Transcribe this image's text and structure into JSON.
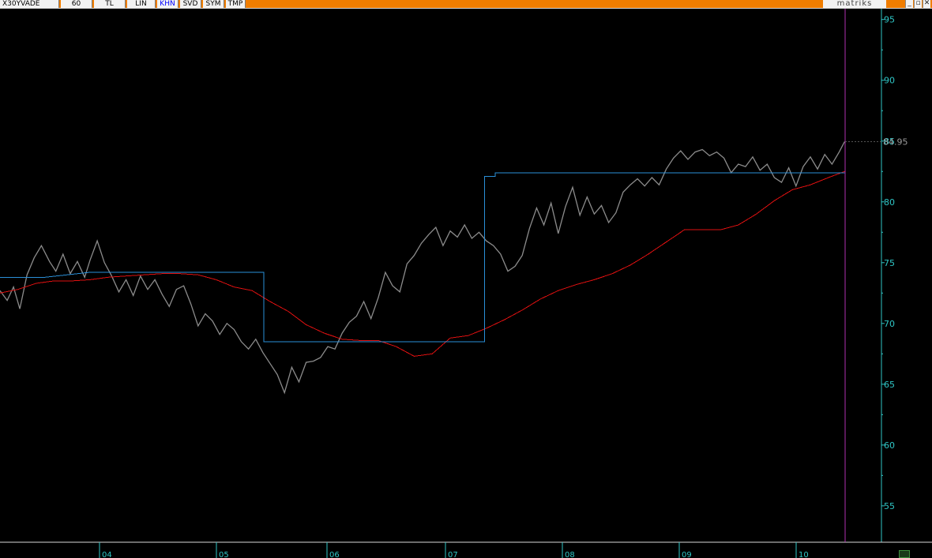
{
  "toolbar": {
    "symbol": "X30YVADE",
    "period": "60",
    "currency": "TL",
    "scale": "LIN",
    "mode": "KHN",
    "svd": "SVD",
    "sym": "SYM",
    "tmp": "TMP",
    "brand": "matriks",
    "minimize": "_",
    "restore": "▫",
    "close": "✕"
  },
  "colors": {
    "background": "#000000",
    "toolbar": "#f07d00",
    "axis": "#2fc6c6",
    "price": "#8c8c8c",
    "red_line": "#e01010",
    "blue_line": "#2a8fd8",
    "cursor": "#b02fb0"
  },
  "chart_data": {
    "type": "line",
    "title": "",
    "ylim": [
      53.5,
      95.5
    ],
    "yticks": [
      55,
      60,
      65,
      70,
      75,
      80,
      85,
      90,
      95
    ],
    "xticks": [
      "04",
      "05",
      "06",
      "07",
      "08",
      "09",
      "10"
    ],
    "last_value": "84.95",
    "series": [
      {
        "color": "#8c8c8c",
        "x": [
          0,
          0.08,
          0.15,
          0.22,
          0.3,
          0.38,
          0.46,
          0.55,
          0.62,
          0.7,
          0.78,
          0.86,
          0.94,
          1.0,
          1.08,
          1.16,
          1.24,
          1.32,
          1.4,
          1.48,
          1.56,
          1.64,
          1.72,
          1.8,
          1.88,
          1.96,
          2.04,
          2.12,
          2.2,
          2.28,
          2.36,
          2.44,
          2.52,
          2.6,
          2.68,
          2.76,
          2.84,
          2.92,
          3.0,
          3.08,
          3.16,
          3.24,
          3.32,
          3.4,
          3.48,
          3.56,
          3.64,
          3.72,
          3.8,
          3.88,
          3.96,
          4.04,
          4.12,
          4.2,
          4.28,
          4.36,
          4.44,
          4.52,
          4.6,
          4.68,
          4.76,
          4.84,
          4.92,
          5.0,
          5.08,
          5.16,
          5.24,
          5.32,
          5.4,
          5.48,
          5.56,
          5.64,
          5.72,
          5.8,
          5.88,
          5.96,
          6.04,
          6.12,
          6.2,
          6.28,
          6.36,
          6.44,
          6.52,
          6.6,
          6.68,
          6.76,
          6.84,
          6.92,
          7.0,
          7.08,
          7.16,
          7.24,
          7.32,
          7.4,
          7.48,
          7.56,
          7.64,
          7.72,
          7.8,
          7.88,
          7.96,
          8.04,
          8.12,
          8.2,
          8.28,
          8.36,
          8.44,
          8.52,
          8.6,
          8.68,
          8.76,
          8.84,
          8.92,
          9.0,
          9.08,
          9.16,
          9.24,
          9.32,
          9.38
        ],
        "values": [
          72.7,
          71.9,
          73.0,
          71.2,
          74.0,
          75.4,
          76.4,
          75.1,
          74.3,
          75.7,
          74.1,
          75.1,
          73.8,
          75.2,
          76.8,
          75.0,
          73.9,
          72.6,
          73.6,
          72.3,
          73.9,
          72.8,
          73.6,
          72.4,
          71.4,
          72.8,
          73.1,
          71.6,
          69.8,
          70.8,
          70.2,
          69.1,
          70.0,
          69.5,
          68.5,
          67.9,
          68.7,
          67.6,
          66.7,
          65.8,
          64.3,
          66.4,
          65.2,
          66.8,
          66.9,
          67.2,
          68.1,
          67.9,
          69.2,
          70.1,
          70.6,
          71.8,
          70.4,
          72.1,
          74.2,
          73.1,
          72.6,
          74.9,
          75.6,
          76.6,
          77.3,
          77.9,
          76.4,
          77.6,
          77.1,
          78.1,
          77.0,
          77.5,
          76.8,
          76.4,
          75.7,
          74.3,
          74.7,
          75.6,
          77.8,
          79.5,
          78.1,
          79.9,
          77.4,
          79.6,
          81.2,
          78.9,
          80.4,
          79.0,
          79.7,
          78.3,
          79.1,
          80.8,
          81.4,
          81.9,
          81.3,
          82.0,
          81.4,
          82.7,
          83.6,
          84.2,
          83.5,
          84.1,
          84.3,
          83.8,
          84.1,
          83.6,
          82.4,
          83.1,
          82.9,
          83.7,
          82.6,
          83.1,
          82.0,
          81.6,
          82.8,
          81.3,
          82.9,
          83.7,
          82.7,
          83.9,
          83.1,
          84.1,
          84.95
        ]
      },
      {
        "color": "#e01010",
        "x": [
          0,
          0.2,
          0.4,
          0.6,
          0.8,
          1.0,
          1.2,
          1.4,
          1.6,
          1.8,
          2.0,
          2.2,
          2.4,
          2.6,
          2.8,
          3.0,
          3.2,
          3.4,
          3.6,
          3.8,
          4.0,
          4.2,
          4.4,
          4.6,
          4.8,
          5.0,
          5.2,
          5.4,
          5.6,
          5.8,
          6.0,
          6.2,
          6.4,
          6.6,
          6.8,
          7.0,
          7.2,
          7.4,
          7.6,
          7.8,
          8.0,
          8.2,
          8.4,
          8.6,
          8.8,
          9.0,
          9.2,
          9.38
        ],
        "values": [
          72.5,
          72.8,
          73.3,
          73.5,
          73.5,
          73.6,
          73.8,
          73.9,
          74.0,
          74.1,
          74.1,
          74.0,
          73.6,
          73.0,
          72.7,
          71.8,
          71.0,
          69.9,
          69.2,
          68.7,
          68.6,
          68.6,
          68.1,
          67.3,
          67.5,
          68.8,
          69.0,
          69.6,
          70.3,
          71.1,
          72.0,
          72.7,
          73.2,
          73.6,
          74.1,
          74.8,
          75.7,
          76.7,
          77.7,
          77.7,
          77.7,
          78.1,
          79.0,
          80.1,
          81.0,
          81.4,
          82.0,
          82.5
        ]
      },
      {
        "color": "#2a8fd8",
        "x": [
          0,
          0.5,
          0.99,
          1.42,
          1.42,
          2.93,
          2.93,
          4.5,
          4.5,
          5.38,
          5.38,
          5.5,
          5.5,
          9.38
        ],
        "values": [
          73.8,
          73.8,
          74.2,
          74.2,
          74.2,
          74.2,
          68.5,
          68.5,
          68.5,
          68.5,
          82.1,
          82.1,
          82.4,
          82.4
        ]
      }
    ]
  }
}
